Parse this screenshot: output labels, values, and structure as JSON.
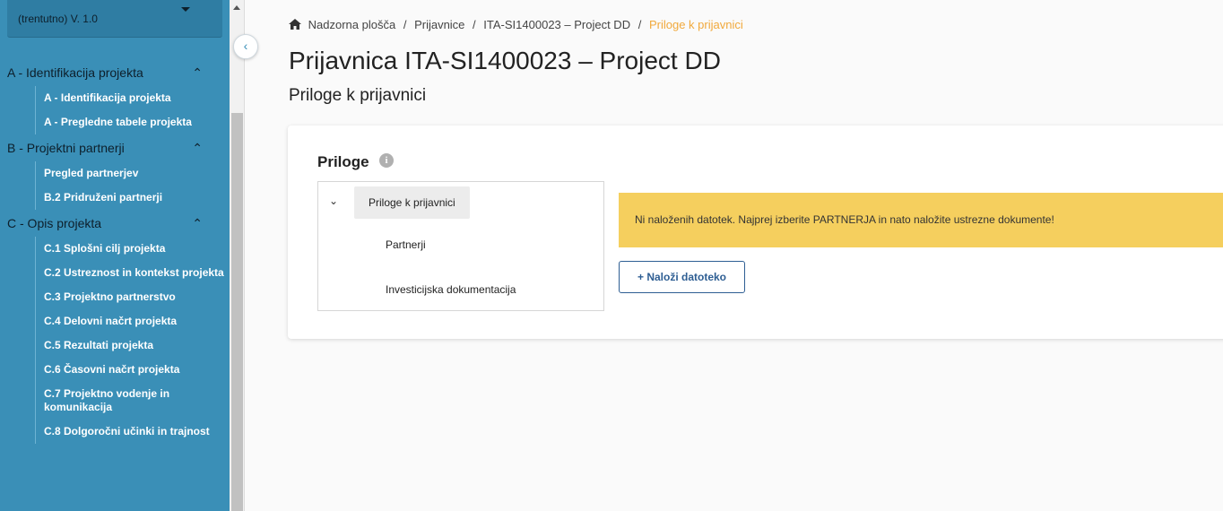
{
  "sidebar": {
    "version_label": "(trentutno) V. 1.0",
    "sections": [
      {
        "title": "A - Identifikacija projekta",
        "items": [
          "A - Identifikacija projekta",
          "A - Pregledne tabele projekta"
        ]
      },
      {
        "title": "B - Projektni partnerji",
        "items": [
          "Pregled partnerjev",
          "B.2 Pridruženi partnerji"
        ]
      },
      {
        "title": "C - Opis projekta",
        "items": [
          "C.1 Splošni cilj projekta",
          "C.2 Ustreznost in kontekst projekta",
          "C.3 Projektno partnerstvo",
          "C.4 Delovni načrt projekta",
          "C.5 Rezultati projekta",
          "C.6 Časovni načrt projekta",
          "C.7 Projektno vodenje in komunikacija",
          "C.8 Dolgoročni učinki in trajnost"
        ]
      }
    ]
  },
  "breadcrumb": {
    "items": [
      "Nadzorna plošča",
      "Prijavnice",
      "ITA-SI1400023 – Project DD"
    ],
    "current": "Priloge k prijavnici",
    "separator": "/"
  },
  "page": {
    "title": "Prijavnica ITA-SI1400023 – Project DD",
    "subtitle": "Priloge k prijavnici"
  },
  "card": {
    "title": "Priloge",
    "info_icon": "info-icon",
    "tree": {
      "root": "Priloge k prijavnici",
      "children": [
        "Partnerji",
        "Investicijska dokumentacija"
      ]
    },
    "alert": "Ni naloženih datotek. Najprej izberite PARTNERJA in nato naložite ustrezne dokumente!",
    "upload_label": "+ Naloži datoteko"
  },
  "colors": {
    "sidebar_bg": "#3a8fb7",
    "breadcrumb_current": "#f1a93b",
    "alert_bg": "#f5cf5e",
    "button_border": "#2e5e93"
  }
}
